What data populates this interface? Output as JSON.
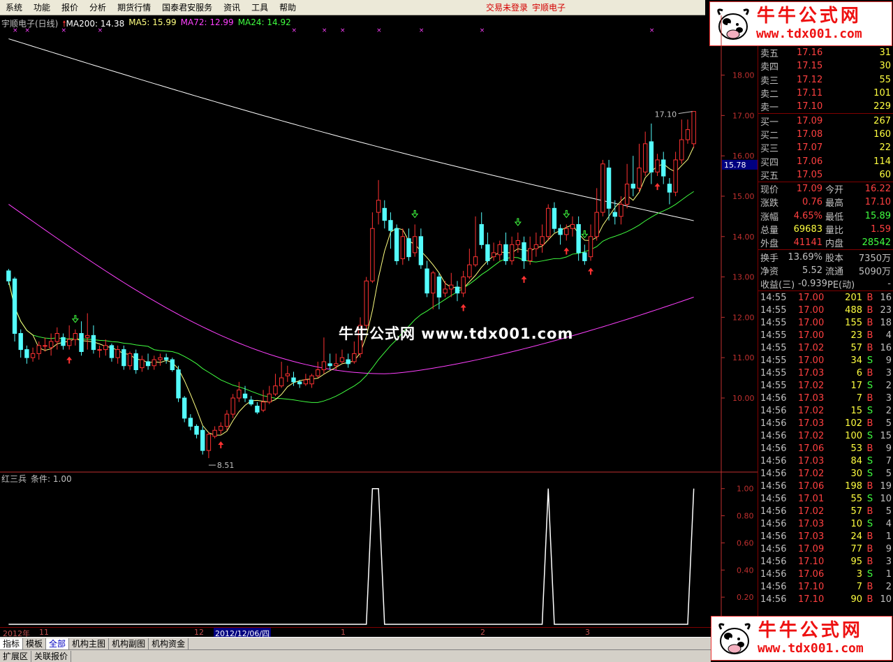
{
  "menu": {
    "items": [
      "系统",
      "功能",
      "报价",
      "分析",
      "期货行情",
      "国泰君安服务",
      "资讯",
      "工具",
      "帮助"
    ],
    "status": "交易未登录",
    "stock_name": "宇顺电子"
  },
  "logo": {
    "main": "牛牛公式网",
    "url": "www.tdx001.com"
  },
  "watermark": "牛牛公式网 www.tdx001.com",
  "legend": {
    "title": "宇顺电子(日线)",
    "ma200": "MA200: 14.38",
    "ma5": "MA5: 15.99",
    "ma72": "MA72: 12.99",
    "ma24": "MA24: 14.92"
  },
  "colors": {
    "up": "#ff3232",
    "down": "#54fcfc",
    "ma200": "#ffffff",
    "ma5": "#ffff80",
    "ma72": "#ff40ff",
    "ma24": "#40ff40",
    "axis": "#c0302f"
  },
  "indicator": {
    "name": "红三兵",
    "cond": "条件: 1.00"
  },
  "chart_data": [
    {
      "type": "candlestick",
      "title": "宇顺电子(日线)",
      "ylim": [
        8.2,
        19.1
      ],
      "y_ticks": [
        "18.00",
        "17.00",
        "16.00",
        "15.00",
        "14.00",
        "13.00",
        "12.00",
        "11.00",
        "10.00"
      ],
      "current_price_label": "15.78",
      "annotations": {
        "high": "17.10",
        "low": "8.51"
      },
      "candles": [
        [
          13.15,
          12.9,
          13.2,
          12.8
        ],
        [
          12.95,
          11.6,
          13.0,
          11.4
        ],
        [
          11.6,
          11.2,
          11.7,
          11.0
        ],
        [
          11.2,
          11.0,
          11.3,
          10.85
        ],
        [
          11.0,
          11.1,
          11.25,
          10.9
        ],
        [
          11.1,
          11.3,
          11.4,
          10.95
        ],
        [
          11.3,
          11.3,
          11.5,
          11.15
        ],
        [
          11.25,
          11.4,
          11.6,
          11.05
        ],
        [
          11.4,
          11.6,
          11.75,
          11.2
        ],
        [
          11.5,
          11.3,
          11.6,
          11.2
        ],
        [
          11.3,
          11.45,
          11.8,
          11.2
        ],
        [
          11.45,
          11.6,
          11.7,
          11.3
        ],
        [
          11.6,
          11.15,
          11.9,
          11.05
        ],
        [
          11.5,
          11.55,
          12.1,
          11.2
        ],
        [
          11.55,
          11.2,
          11.8,
          11.1
        ],
        [
          11.2,
          11.2,
          11.3,
          11.0
        ],
        [
          11.2,
          11.3,
          11.45,
          11.05
        ],
        [
          11.3,
          11.0,
          11.35,
          10.9
        ],
        [
          11.0,
          11.2,
          11.3,
          10.85
        ],
        [
          11.2,
          10.8,
          11.3,
          10.7
        ],
        [
          10.8,
          11.1,
          11.15,
          10.7
        ],
        [
          11.1,
          10.7,
          11.2,
          10.6
        ],
        [
          10.75,
          10.95,
          11.05,
          10.65
        ],
        [
          10.9,
          10.8,
          11.1,
          10.7
        ],
        [
          10.8,
          10.95,
          11.05,
          10.7
        ],
        [
          10.95,
          11.0,
          11.1,
          10.8
        ],
        [
          11.0,
          10.95,
          11.1,
          10.85
        ],
        [
          10.95,
          10.7,
          11.0,
          10.65
        ],
        [
          10.7,
          10.0,
          10.8,
          9.9
        ],
        [
          10.0,
          9.5,
          10.05,
          9.4
        ],
        [
          9.5,
          9.3,
          9.6,
          9.2
        ],
        [
          9.3,
          9.1,
          9.35,
          9.0
        ],
        [
          9.2,
          8.7,
          9.3,
          8.6
        ],
        [
          8.7,
          9.1,
          9.15,
          8.51
        ],
        [
          9.05,
          9.2,
          9.3,
          9.0
        ],
        [
          9.2,
          9.3,
          9.4,
          9.1
        ],
        [
          9.3,
          9.6,
          9.7,
          9.2
        ],
        [
          9.6,
          10.0,
          10.1,
          9.5
        ],
        [
          10.0,
          10.2,
          10.4,
          9.9
        ],
        [
          10.1,
          10.0,
          10.3,
          9.9
        ],
        [
          9.95,
          9.85,
          10.05,
          9.8
        ],
        [
          9.8,
          9.65,
          9.9,
          9.6
        ],
        [
          9.7,
          9.9,
          10.2,
          9.65
        ],
        [
          9.9,
          10.1,
          10.3,
          9.85
        ],
        [
          10.1,
          10.3,
          10.6,
          10.05
        ],
        [
          10.3,
          10.5,
          10.9,
          10.25
        ],
        [
          10.55,
          10.6,
          10.8,
          10.4
        ],
        [
          10.5,
          10.4,
          10.65,
          10.3
        ],
        [
          10.4,
          10.35,
          10.45,
          10.25
        ],
        [
          10.35,
          10.45,
          10.6,
          10.3
        ],
        [
          10.35,
          10.55,
          10.6,
          10.25
        ],
        [
          10.55,
          10.7,
          10.9,
          10.5
        ],
        [
          10.7,
          10.9,
          11.5,
          10.6
        ],
        [
          10.85,
          10.8,
          11.1,
          10.7
        ],
        [
          10.8,
          10.85,
          11.1,
          10.7
        ],
        [
          10.9,
          11.0,
          11.2,
          10.85
        ],
        [
          10.95,
          10.85,
          11.1,
          10.75
        ],
        [
          10.9,
          11.1,
          11.4,
          10.85
        ],
        [
          11.1,
          11.8,
          12.0,
          11.0
        ],
        [
          11.8,
          12.9,
          13.0,
          11.7
        ],
        [
          12.9,
          14.2,
          14.6,
          12.85
        ],
        [
          14.6,
          14.9,
          15.4,
          14.3
        ],
        [
          14.7,
          14.4,
          14.9,
          14.2
        ],
        [
          14.4,
          14.15,
          14.6,
          13.7
        ],
        [
          14.2,
          13.4,
          14.3,
          13.3
        ],
        [
          13.45,
          14.0,
          14.2,
          13.3
        ],
        [
          13.95,
          13.5,
          14.2,
          13.4
        ],
        [
          13.6,
          14.0,
          14.3,
          13.5
        ],
        [
          14.0,
          13.3,
          14.2,
          13.2
        ],
        [
          13.2,
          12.6,
          13.4,
          12.5
        ],
        [
          12.6,
          13.1,
          13.15,
          12.2
        ],
        [
          13.0,
          12.5,
          13.1,
          12.2
        ],
        [
          12.6,
          12.7,
          12.9,
          12.5
        ],
        [
          12.7,
          12.8,
          13.1,
          12.5
        ],
        [
          12.75,
          12.6,
          12.9,
          12.4
        ],
        [
          12.6,
          13.0,
          13.15,
          12.5
        ],
        [
          13.0,
          13.3,
          13.7,
          12.95
        ],
        [
          13.3,
          13.5,
          14.5,
          13.25
        ],
        [
          14.3,
          13.8,
          14.6,
          13.7
        ],
        [
          13.8,
          13.4,
          14.1,
          13.3
        ],
        [
          13.5,
          13.6,
          13.85,
          13.4
        ],
        [
          13.55,
          13.8,
          13.9,
          13.4
        ],
        [
          13.8,
          13.4,
          14.1,
          13.3
        ],
        [
          13.4,
          13.8,
          14.0,
          13.3
        ],
        [
          13.8,
          13.9,
          14.1,
          13.6
        ],
        [
          13.85,
          13.4,
          14.0,
          13.2
        ],
        [
          13.4,
          13.7,
          14.0,
          13.3
        ],
        [
          13.7,
          13.8,
          14.1,
          13.5
        ],
        [
          13.8,
          14.0,
          14.3,
          13.6
        ],
        [
          14.0,
          14.7,
          14.8,
          13.9
        ],
        [
          14.7,
          14.2,
          14.85,
          14.1
        ],
        [
          14.2,
          14.05,
          14.3,
          13.8
        ],
        [
          14.05,
          14.2,
          14.3,
          13.9
        ],
        [
          14.2,
          14.3,
          14.5,
          14.0
        ],
        [
          14.3,
          13.6,
          14.5,
          13.4
        ],
        [
          13.6,
          13.4,
          13.8,
          13.3
        ],
        [
          13.5,
          14.0,
          14.3,
          13.4
        ],
        [
          14.0,
          14.6,
          15.2,
          13.9
        ],
        [
          14.6,
          15.8,
          15.9,
          14.5
        ],
        [
          15.7,
          14.7,
          15.9,
          14.4
        ],
        [
          14.6,
          14.5,
          14.9,
          14.3
        ],
        [
          14.5,
          14.8,
          15.0,
          14.3
        ],
        [
          14.8,
          15.3,
          15.8,
          14.7
        ],
        [
          15.3,
          15.2,
          16.0,
          15.0
        ],
        [
          15.2,
          15.7,
          16.3,
          15.1
        ],
        [
          15.6,
          16.3,
          16.6,
          15.5
        ],
        [
          16.35,
          15.6,
          16.8,
          15.3
        ],
        [
          15.6,
          15.9,
          16.05,
          15.5
        ],
        [
          15.9,
          15.5,
          16.1,
          15.3
        ],
        [
          15.3,
          15.1,
          15.45,
          14.8
        ],
        [
          15.1,
          15.9,
          16.1,
          15.0
        ],
        [
          15.9,
          16.4,
          16.9,
          15.8
        ],
        [
          16.4,
          16.65,
          16.9,
          16.3
        ],
        [
          16.3,
          17.1,
          17.1,
          16.2
        ]
      ]
    },
    {
      "type": "line",
      "title": "红三兵",
      "ylim": [
        0,
        1.05
      ],
      "y_ticks": [
        "1.00",
        "0.80",
        "0.60",
        "0.40",
        "0.20"
      ],
      "values": [
        0,
        0,
        0,
        0,
        0,
        0,
        0,
        0,
        0,
        0,
        0,
        0,
        0,
        0,
        0,
        0,
        0,
        0,
        0,
        0,
        0,
        0,
        0,
        0,
        0,
        0,
        0,
        0,
        0,
        0,
        0,
        0,
        0,
        0,
        0,
        0,
        0,
        0,
        0,
        0,
        0,
        0,
        0,
        0,
        0,
        0,
        0,
        0,
        0,
        0,
        0,
        0,
        0,
        0,
        0,
        0,
        0,
        0,
        0,
        0,
        1,
        1,
        0,
        0,
        0,
        0,
        0,
        0,
        0,
        0,
        0,
        0,
        0,
        0,
        0,
        0,
        0,
        0,
        0,
        0,
        0,
        0,
        0,
        0,
        0,
        0,
        0,
        0,
        0,
        1,
        0,
        0,
        0,
        0,
        0,
        0,
        0,
        0,
        0,
        0,
        0,
        0,
        0,
        0,
        0,
        0,
        0,
        0,
        0,
        0,
        0,
        0,
        0,
        1
      ]
    }
  ],
  "time_axis": [
    "2012年",
    "11",
    "12",
    "2012/12/06/四",
    "1",
    "2",
    "3"
  ],
  "quotes": {
    "sells": [
      {
        "label": "卖五",
        "price": "17.16",
        "vol": "31"
      },
      {
        "label": "卖四",
        "price": "17.15",
        "vol": "30"
      },
      {
        "label": "卖三",
        "price": "17.12",
        "vol": "55"
      },
      {
        "label": "卖二",
        "price": "17.11",
        "vol": "101"
      },
      {
        "label": "卖一",
        "price": "17.10",
        "vol": "229"
      }
    ],
    "buys": [
      {
        "label": "买一",
        "price": "17.09",
        "vol": "267"
      },
      {
        "label": "买二",
        "price": "17.08",
        "vol": "160"
      },
      {
        "label": "买三",
        "price": "17.07",
        "vol": "22"
      },
      {
        "label": "买四",
        "price": "17.06",
        "vol": "114"
      },
      {
        "label": "买五",
        "price": "17.05",
        "vol": "60"
      }
    ]
  },
  "stats": [
    {
      "l1": "现价",
      "v1": "17.09",
      "c1": "#ff4040",
      "l2": "今开",
      "v2": "16.22",
      "c2": "#ff4040"
    },
    {
      "l1": "涨跌",
      "v1": "0.76",
      "c1": "#ff4040",
      "l2": "最高",
      "v2": "17.10",
      "c2": "#ff4040"
    },
    {
      "l1": "涨幅",
      "v1": "4.65%",
      "c1": "#ff4040",
      "l2": "最低",
      "v2": "15.89",
      "c2": "#40ff40"
    },
    {
      "l1": "总量",
      "v1": "69683",
      "c1": "#ffff40",
      "l2": "量比",
      "v2": "1.59",
      "c2": "#ff4040"
    },
    {
      "l1": "外盘",
      "v1": "41141",
      "c1": "#ff4040",
      "l2": "内盘",
      "v2": "28542",
      "c2": "#40ff40"
    }
  ],
  "stats2": [
    {
      "l1": "换手",
      "v1": "13.69%",
      "c1": "#c0c0c0",
      "l2": "股本",
      "v2": "7350万",
      "c2": "#c0c0c0"
    },
    {
      "l1": "净资",
      "v1": "5.52",
      "c1": "#c0c0c0",
      "l2": "流通",
      "v2": "5090万",
      "c2": "#c0c0c0"
    },
    {
      "l1": "收益(三)",
      "v1": "-0.939",
      "c1": "#c0c0c0",
      "l2": "PE(动)",
      "v2": "-",
      "c2": "#c0c0c0"
    }
  ],
  "ticks": [
    {
      "t": "14:55",
      "p": "17.00",
      "v": "201",
      "bs": "B",
      "n": "16"
    },
    {
      "t": "14:55",
      "p": "17.00",
      "v": "488",
      "bs": "B",
      "n": "23"
    },
    {
      "t": "14:55",
      "p": "17.00",
      "v": "155",
      "bs": "B",
      "n": "18"
    },
    {
      "t": "14:55",
      "p": "17.00",
      "v": "23",
      "bs": "B",
      "n": "4"
    },
    {
      "t": "14:55",
      "p": "17.02",
      "v": "57",
      "bs": "B",
      "n": "16"
    },
    {
      "t": "14:55",
      "p": "17.00",
      "v": "34",
      "bs": "S",
      "n": "9"
    },
    {
      "t": "14:55",
      "p": "17.03",
      "v": "6",
      "bs": "B",
      "n": "3"
    },
    {
      "t": "14:55",
      "p": "17.02",
      "v": "17",
      "bs": "S",
      "n": "2"
    },
    {
      "t": "14:56",
      "p": "17.03",
      "v": "7",
      "bs": "B",
      "n": "3"
    },
    {
      "t": "14:56",
      "p": "17.02",
      "v": "15",
      "bs": "S",
      "n": "2"
    },
    {
      "t": "14:56",
      "p": "17.03",
      "v": "102",
      "bs": "B",
      "n": "5"
    },
    {
      "t": "14:56",
      "p": "17.02",
      "v": "100",
      "bs": "S",
      "n": "15"
    },
    {
      "t": "14:56",
      "p": "17.06",
      "v": "53",
      "bs": "B",
      "n": "9"
    },
    {
      "t": "14:56",
      "p": "17.03",
      "v": "84",
      "bs": "S",
      "n": "7"
    },
    {
      "t": "14:56",
      "p": "17.02",
      "v": "30",
      "bs": "S",
      "n": "5"
    },
    {
      "t": "14:56",
      "p": "17.06",
      "v": "198",
      "bs": "B",
      "n": "19"
    },
    {
      "t": "14:56",
      "p": "17.01",
      "v": "55",
      "bs": "S",
      "n": "10"
    },
    {
      "t": "14:56",
      "p": "17.02",
      "v": "57",
      "bs": "B",
      "n": "5"
    },
    {
      "t": "14:56",
      "p": "17.03",
      "v": "10",
      "bs": "S",
      "n": "4"
    },
    {
      "t": "14:56",
      "p": "17.03",
      "v": "24",
      "bs": "B",
      "n": "1"
    },
    {
      "t": "14:56",
      "p": "17.09",
      "v": "77",
      "bs": "B",
      "n": "9"
    },
    {
      "t": "14:56",
      "p": "17.10",
      "v": "95",
      "bs": "B",
      "n": "3"
    },
    {
      "t": "14:56",
      "p": "17.06",
      "v": "3",
      "bs": "S",
      "n": "1"
    },
    {
      "t": "14:56",
      "p": "17.10",
      "v": "7",
      "bs": "B",
      "n": "2"
    },
    {
      "t": "14:56",
      "p": "17.10",
      "v": "90",
      "bs": "B",
      "n": "10"
    }
  ],
  "tabs": [
    "指标",
    "模板",
    "全部",
    "机构主图",
    "机构副图",
    "机构资金"
  ],
  "bottom_tabs": [
    "扩展区",
    "关联报价"
  ]
}
